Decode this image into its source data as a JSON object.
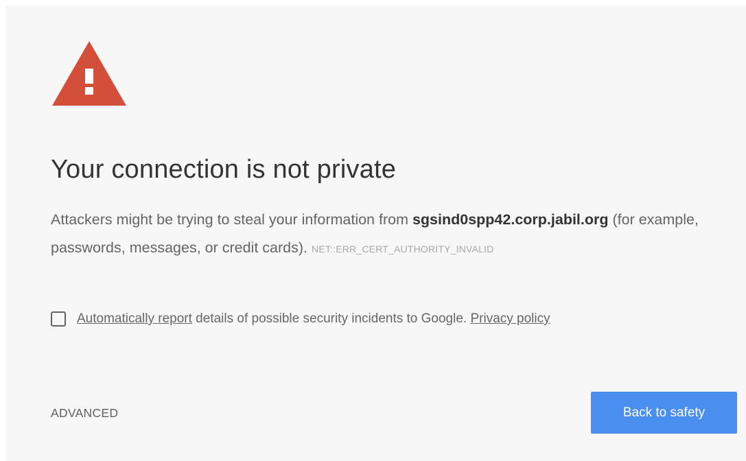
{
  "icon": {
    "name": "warning-icon",
    "color": "#d34f3a",
    "glyph": "!"
  },
  "title": "Your connection is not private",
  "message": {
    "prefix": "Attackers might be trying to steal your information from ",
    "host": "sgsind0spp42.corp.jabil.org",
    "suffix": " (for example, passwords, messages, or credit cards). ",
    "error_code": "NET::ERR_CERT_AUTHORITY_INVALID"
  },
  "report": {
    "checked": false,
    "link_label": "Automatically report",
    "text": " details of possible security incidents to Google. ",
    "privacy_label": "Privacy policy"
  },
  "buttons": {
    "advanced_label": "ADVANCED",
    "back_label": "Back to safety",
    "back_color": "#4a8ef0"
  }
}
